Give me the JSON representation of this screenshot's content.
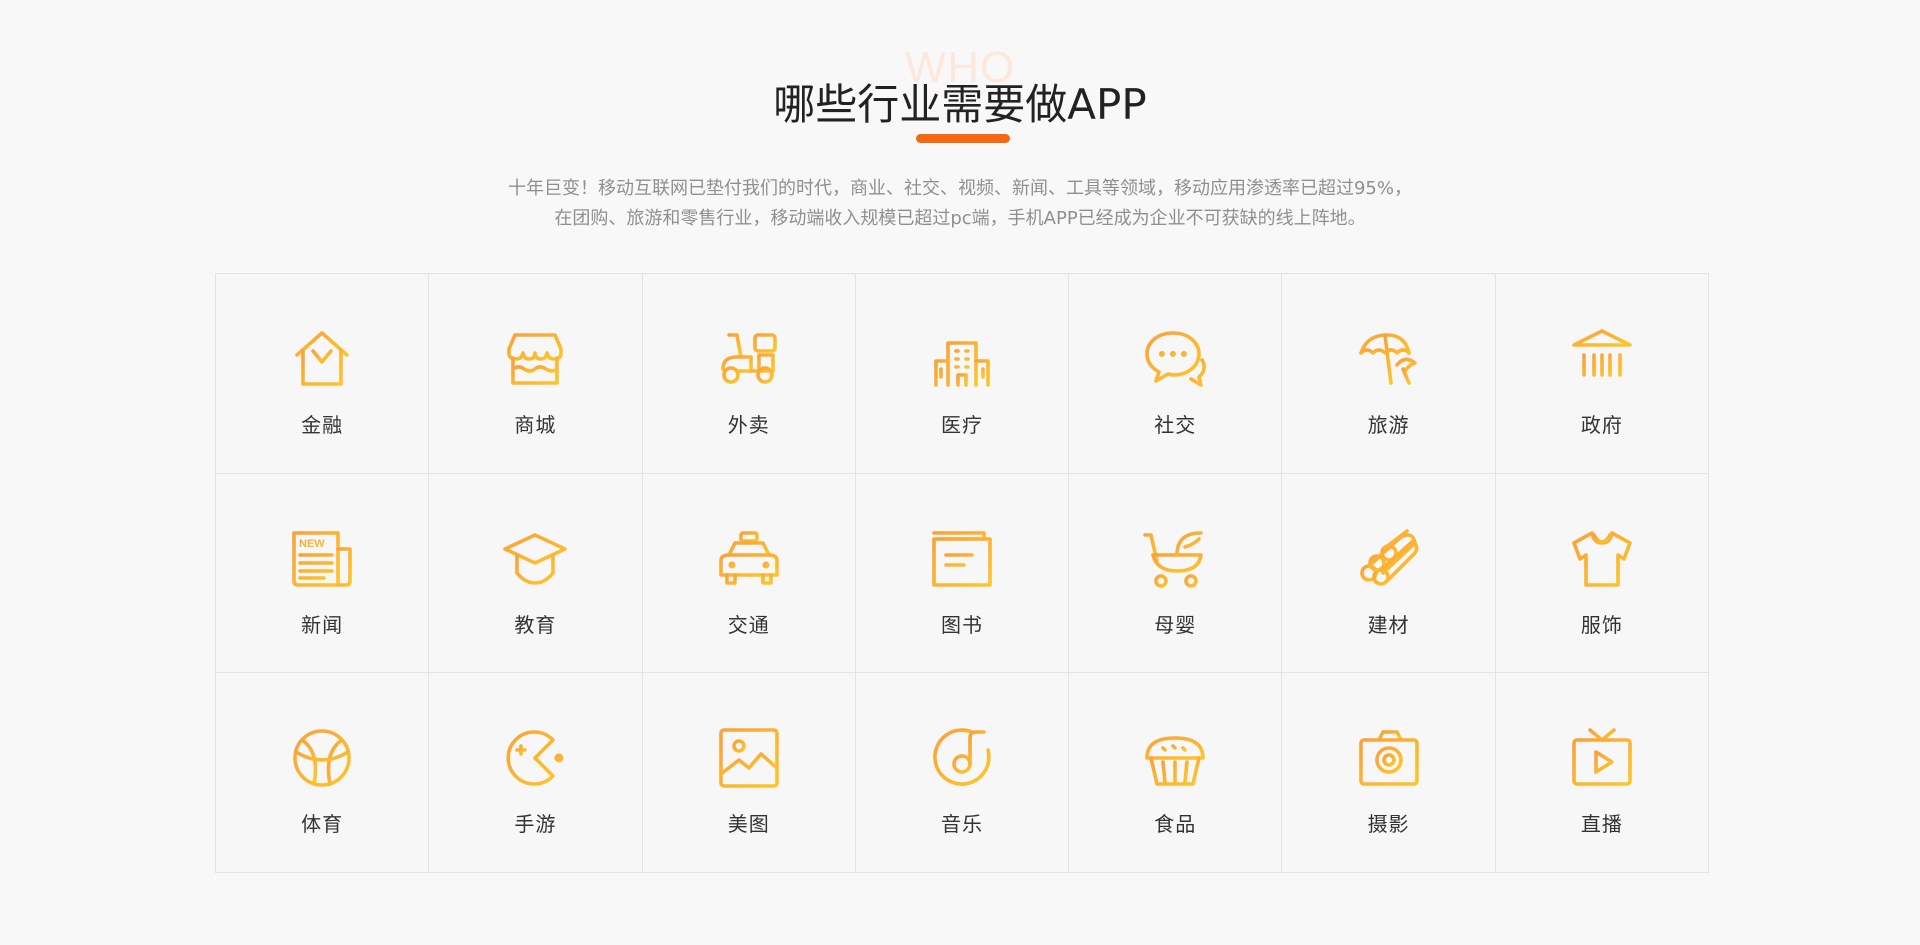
{
  "header": {
    "watermark": "WHO",
    "title": "哪些行业需要做APP",
    "subtitle_line1": "十年巨变！移动互联网已垫付我们的时代，商业、社交、视频、新闻、工具等领域，移动应用渗透率已超过95%，",
    "subtitle_line2": "在团购、旅游和零售行业，移动端收入规模已超过pc端，手机APP已经成为企业不可获缺的线上阵地。"
  },
  "colors": {
    "background": "#f8f8f8",
    "accent": "#f4680f",
    "icon_gradient_start": "#f9a23c",
    "icon_gradient_end": "#fdc52a",
    "grid_border": "#e3e3e3"
  },
  "industries": [
    {
      "label": "金融",
      "icon": "finance-house-yen-icon"
    },
    {
      "label": "商城",
      "icon": "shop-storefront-icon"
    },
    {
      "label": "外卖",
      "icon": "delivery-scooter-icon"
    },
    {
      "label": "医疗",
      "icon": "hospital-building-icon"
    },
    {
      "label": "社交",
      "icon": "chat-bubbles-icon"
    },
    {
      "label": "旅游",
      "icon": "beach-umbrella-icon"
    },
    {
      "label": "政府",
      "icon": "government-building-icon"
    },
    {
      "label": "新闻",
      "icon": "newspaper-icon"
    },
    {
      "label": "教育",
      "icon": "graduation-cap-icon"
    },
    {
      "label": "交通",
      "icon": "taxi-icon"
    },
    {
      "label": "图书",
      "icon": "book-icon"
    },
    {
      "label": "母婴",
      "icon": "baby-stroller-icon"
    },
    {
      "label": "建材",
      "icon": "building-materials-logs-icon"
    },
    {
      "label": "服饰",
      "icon": "tshirt-icon"
    },
    {
      "label": "体育",
      "icon": "basketball-icon"
    },
    {
      "label": "手游",
      "icon": "pacman-game-icon"
    },
    {
      "label": "美图",
      "icon": "picture-icon"
    },
    {
      "label": "音乐",
      "icon": "music-note-icon"
    },
    {
      "label": "食品",
      "icon": "cupcake-icon"
    },
    {
      "label": "摄影",
      "icon": "camera-icon"
    },
    {
      "label": "直播",
      "icon": "live-tv-icon"
    }
  ],
  "icon_text": {
    "news_badge": "NEW"
  }
}
